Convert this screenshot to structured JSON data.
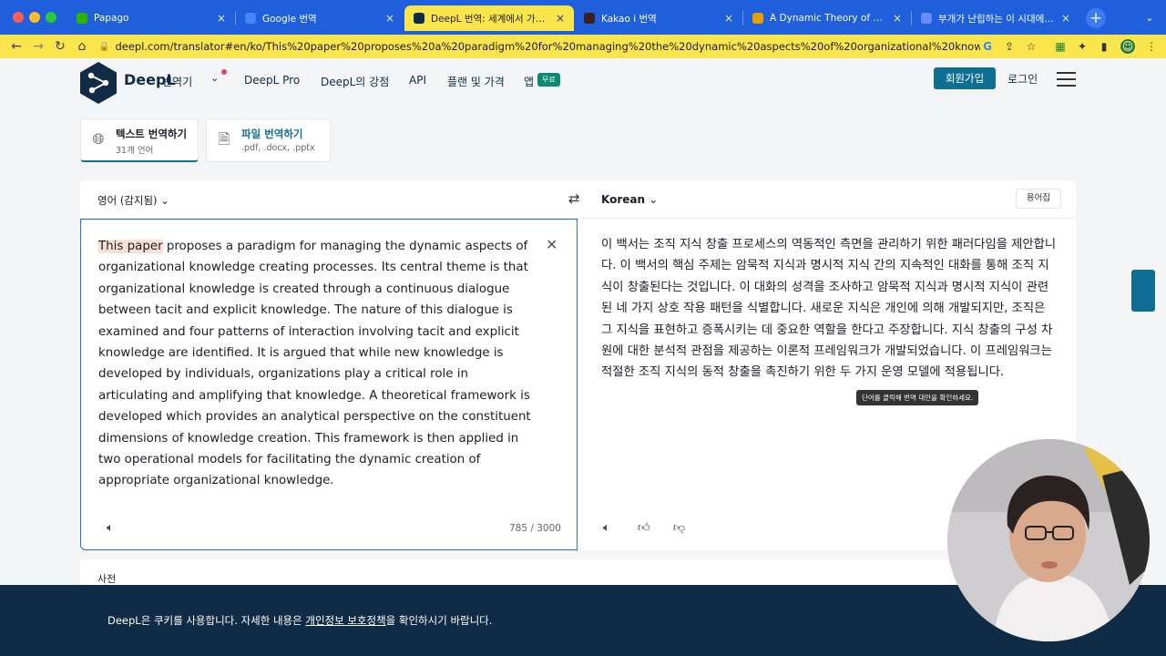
{
  "browser": {
    "tabs": [
      {
        "label": "Papago",
        "color": "#2db400"
      },
      {
        "label": "Google 번역",
        "color": "#4285f4"
      },
      {
        "label": "DeepL 번역: 세계에서 가장 정확한",
        "color": "#0f2b46",
        "active": true
      },
      {
        "label": "Kakao i 번역",
        "color": "#3c1e1e"
      },
      {
        "label": "A Dynamic Theory of Organiz",
        "color": "#e8a000"
      },
      {
        "label": "부개가 난립하는 이 시대에 신경 써야",
        "color": "#6b8cff"
      }
    ],
    "url": "deepl.com/translator#en/ko/This%20paper%20proposes%20a%20paradigm%20for%20managing%20the%20dynamic%20aspects%20of%20organizational%20knowledge%20cr...",
    "new_tab_symbol": "+",
    "tab_close_symbol": "×"
  },
  "header": {
    "brand": "DeepL",
    "brand_sub": "번역기",
    "nav": [
      "DeepL Pro",
      "DeepL의 강점",
      "API",
      "플랜 및 가격",
      "앱"
    ],
    "app_badge": "무료",
    "signup": "회원가입",
    "login": "로그인"
  },
  "mode_tabs": {
    "text_title": "텍스트 번역하기",
    "text_sub": "31개 언어",
    "file_title": "파일 번역하기",
    "file_sub": ".pdf, .docx, .pptx"
  },
  "translator": {
    "source_lang": "영어 (감지됨)",
    "target_lang": "Korean",
    "glossary": "용어집",
    "source_highlight": "This paper",
    "source_rest": " proposes a paradigm for managing the dynamic aspects of organizational knowledge creating processes. Its central theme is that organizational knowledge is created through a continuous dialogue between tacit and explicit knowledge. The nature of this dialogue is examined and four patterns of interaction involving tacit and explicit knowledge are identified. It is argued that while new knowledge is developed by individuals, organizations play a critical role in articulating and amplifying that knowledge. A theoretical framework is developed which provides an analytical perspective on the constituent dimensions of knowledge creation. This framework is then applied in two operational models for facilitating the dynamic creation of appropriate organizational knowledge.",
    "counter": "785 / 3000",
    "target_text": "이 백서는 조직 지식 창출 프로세스의 역동적인 측면을 관리하기 위한 패러다임을 제안합니다. 이 백서의 핵심 주제는 암묵적 지식과 명시적 지식 간의 지속적인 대화를 통해 조직 지식이 창출된다는 것입니다. 이 대화의 성격을 조사하고 암묵적 지식과 명시적 지식이 관련된 네 가지 상호 작용 패턴을 식별합니다. 새로운 지식은 개인에 의해 개발되지만, 조직은 그 지식을 표현하고 증폭시키는 데 중요한 역할을 한다고 주장합니다. 지식 창출의 구성 차원에 대한 분석적 관점을 제공하는 이론적 프레임워크가 개발되었습니다. 이 프레임워크는 적절한 조직 지식의 동적 창출을 촉진하기 위한 두 가지 운영 모델에 적용됩니다.",
    "tooltip": "단어를 클릭해 번역 대안을 확인하세요."
  },
  "dictionary": {
    "label": "사전"
  },
  "cookie": {
    "before": "DeepL은 쿠키를 사용합니다. 자세한 내용은 ",
    "link": "개인정보 보호정책",
    "after": "을 확인하시기 바랍니다."
  }
}
